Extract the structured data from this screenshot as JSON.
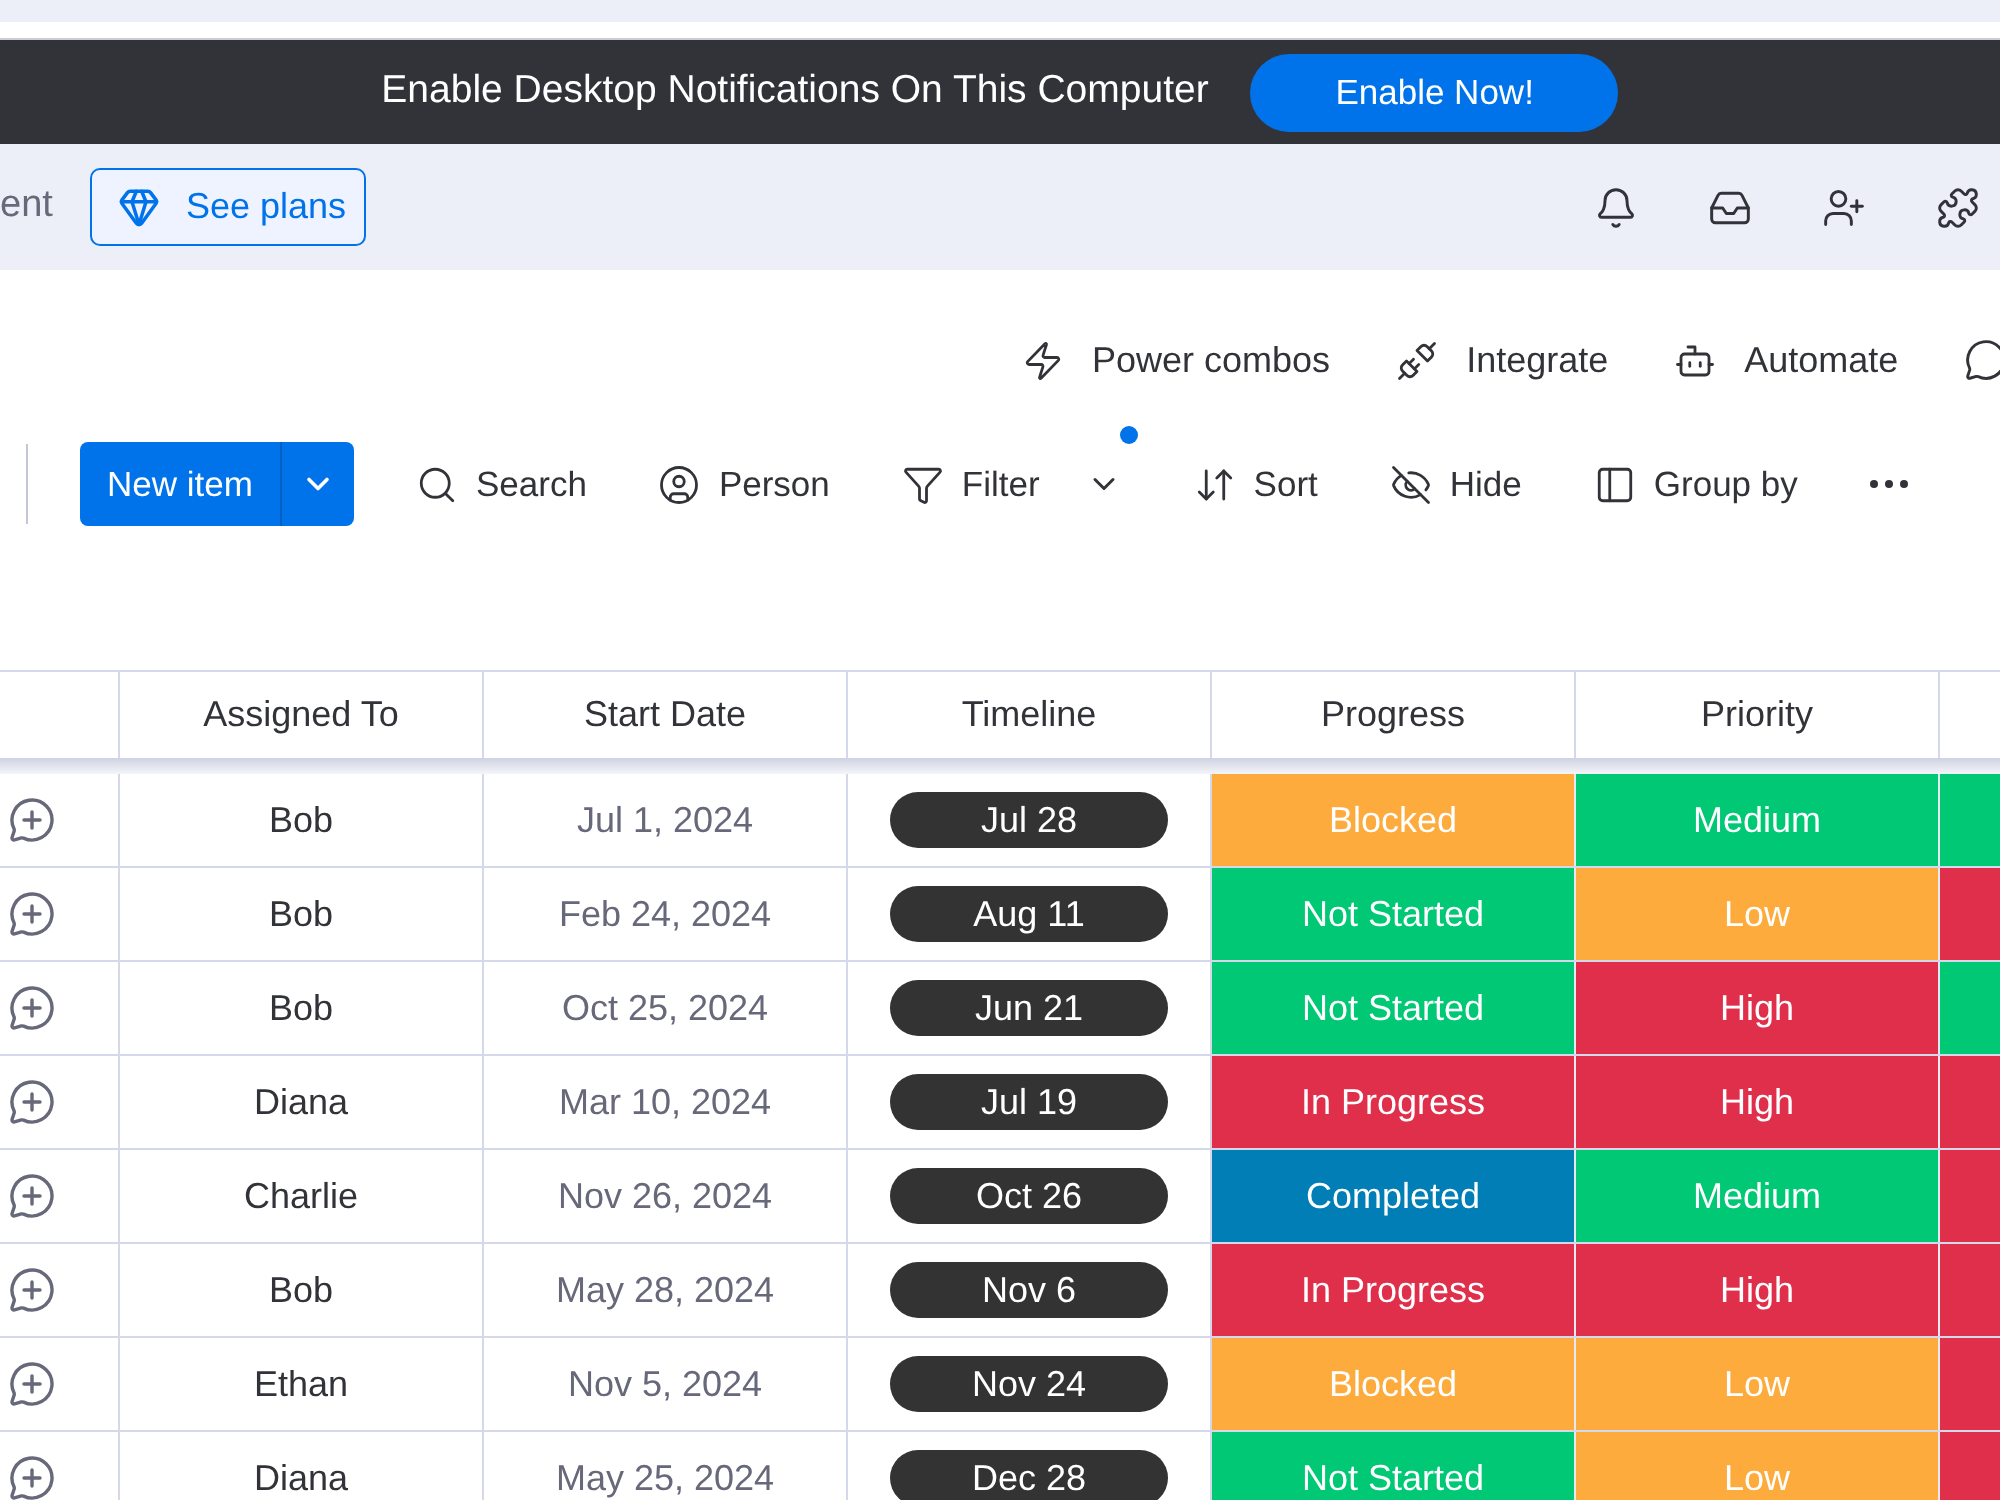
{
  "top_banner": {
    "message": "Enable Desktop Notifications On This Computer",
    "button": "Enable Now!"
  },
  "header_bar": {
    "cut_text": "ent",
    "plans_button": "See plans"
  },
  "board_actions": [
    {
      "label": "Power combos"
    },
    {
      "label": "Integrate"
    },
    {
      "label": "Automate"
    }
  ],
  "toolbar": {
    "new_item_button": "New item",
    "tools": [
      {
        "label": "Search",
        "dot": false,
        "has_menu": false
      },
      {
        "label": "Person",
        "dot": false,
        "has_menu": false
      },
      {
        "label": "Filter",
        "dot": true,
        "has_menu": true
      },
      {
        "label": "Sort",
        "dot": false,
        "has_menu": false
      },
      {
        "label": "Hide",
        "dot": false,
        "has_menu": false
      },
      {
        "label": "Group by",
        "dot": false,
        "has_menu": false
      }
    ]
  },
  "table": {
    "columns": [
      "Assigned To",
      "Start Date",
      "Timeline",
      "Progress",
      "Priority"
    ],
    "rows": [
      {
        "assigned_to": "Bob",
        "start_date": "Jul 1, 2024",
        "timeline": "Jul 28",
        "progress": {
          "label": "Blocked",
          "color": "#fdab3d"
        },
        "priority": {
          "label": "Medium",
          "color": "#00c875"
        },
        "column_7": {
          "color": "#00c875"
        }
      },
      {
        "assigned_to": "Bob",
        "start_date": "Feb 24, 2024",
        "timeline": "Aug 11",
        "progress": {
          "label": "Not Started",
          "color": "#00c875"
        },
        "priority": {
          "label": "Low",
          "color": "#fdab3d"
        },
        "column_7": {
          "color": "#df2f4a"
        }
      },
      {
        "assigned_to": "Bob",
        "start_date": "Oct 25, 2024",
        "timeline": "Jun 21",
        "progress": {
          "label": "Not Started",
          "color": "#00c875"
        },
        "priority": {
          "label": "High",
          "color": "#df2f4a"
        },
        "column_7": {
          "color": "#00c875"
        }
      },
      {
        "assigned_to": "Diana",
        "start_date": "Mar 10, 2024",
        "timeline": "Jul 19",
        "progress": {
          "label": "In Progress",
          "color": "#df2f4a"
        },
        "priority": {
          "label": "High",
          "color": "#df2f4a"
        },
        "column_7": {
          "color": "#df2f4a"
        }
      },
      {
        "assigned_to": "Charlie",
        "start_date": "Nov 26, 2024",
        "timeline": "Oct 26",
        "progress": {
          "label": "Completed",
          "color": "#007eb5"
        },
        "priority": {
          "label": "Medium",
          "color": "#00c875"
        },
        "column_7": {
          "color": "#df2f4a"
        }
      },
      {
        "assigned_to": "Bob",
        "start_date": "May 28, 2024",
        "timeline": "Nov 6",
        "progress": {
          "label": "In Progress",
          "color": "#df2f4a"
        },
        "priority": {
          "label": "High",
          "color": "#df2f4a"
        },
        "column_7": {
          "color": "#df2f4a"
        }
      },
      {
        "assigned_to": "Ethan",
        "start_date": "Nov 5, 2024",
        "timeline": "Nov 24",
        "progress": {
          "label": "Blocked",
          "color": "#fdab3d"
        },
        "priority": {
          "label": "Low",
          "color": "#fdab3d"
        },
        "column_7": {
          "color": "#df2f4a"
        }
      },
      {
        "assigned_to": "Diana",
        "start_date": "May 25, 2024",
        "timeline": "Dec 28",
        "progress": {
          "label": "Not Started",
          "color": "#00c875"
        },
        "priority": {
          "label": "Low",
          "color": "#fdab3d"
        },
        "column_7": {
          "color": "#df2f4a"
        }
      }
    ]
  }
}
